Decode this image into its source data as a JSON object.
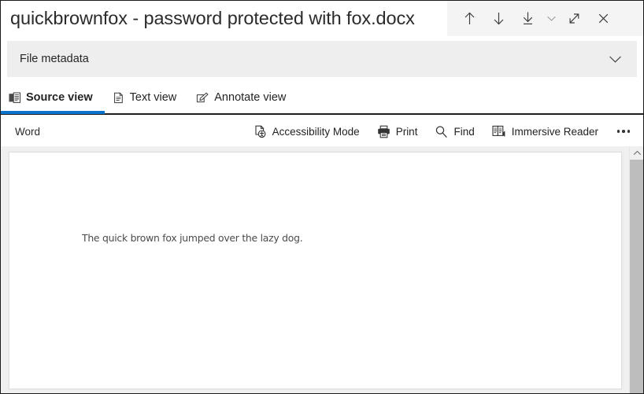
{
  "window": {
    "title": "quickbrownfox - password protected with fox.docx",
    "actions": [
      {
        "name": "previous-item-button",
        "icon": "arrow-up-icon",
        "label": "Previous"
      },
      {
        "name": "next-item-button",
        "icon": "arrow-down-icon",
        "label": "Next"
      },
      {
        "name": "download-button",
        "icon": "download-icon",
        "label": "Download"
      },
      {
        "name": "download-options-button",
        "icon": "chevron-down-icon",
        "label": "Download options"
      },
      {
        "name": "expand-button",
        "icon": "expand-diagonal-icon",
        "label": "Expand"
      },
      {
        "name": "close-button",
        "icon": "close-icon",
        "label": "Close"
      }
    ]
  },
  "metadata": {
    "label": "File metadata",
    "expand_icon": "chevron-down-icon"
  },
  "tabs": [
    {
      "label": "Source view",
      "icon": "source-view-icon",
      "active": true
    },
    {
      "label": "Text view",
      "icon": "text-view-icon",
      "active": false
    },
    {
      "label": "Annotate view",
      "icon": "annotate-view-icon",
      "active": false
    }
  ],
  "word_toolbar": {
    "app_label": "Word",
    "items": [
      {
        "label": "Accessibility Mode",
        "icon": "accessibility-mode-icon"
      },
      {
        "label": "Print",
        "icon": "printer-icon"
      },
      {
        "label": "Find",
        "icon": "search-icon"
      },
      {
        "label": "Immersive Reader",
        "icon": "immersive-reader-icon"
      }
    ],
    "more_label": "More options",
    "more_icon": "ellipsis-icon"
  },
  "document": {
    "body_text": "The quick brown fox jumped over the lazy dog."
  },
  "scrollbar": {
    "up_arrow_icon": "chevron-up-icon"
  },
  "colors": {
    "accent": "#0a74cc",
    "titlebar_actions_bg": "#f4f4f4",
    "metadata_bg": "#eeeeee",
    "viewport_bg": "#f0f0f0",
    "scroll_thumb": "#bdbdbd",
    "text_primary": "#242424",
    "doc_text": "#4b4b4b"
  }
}
